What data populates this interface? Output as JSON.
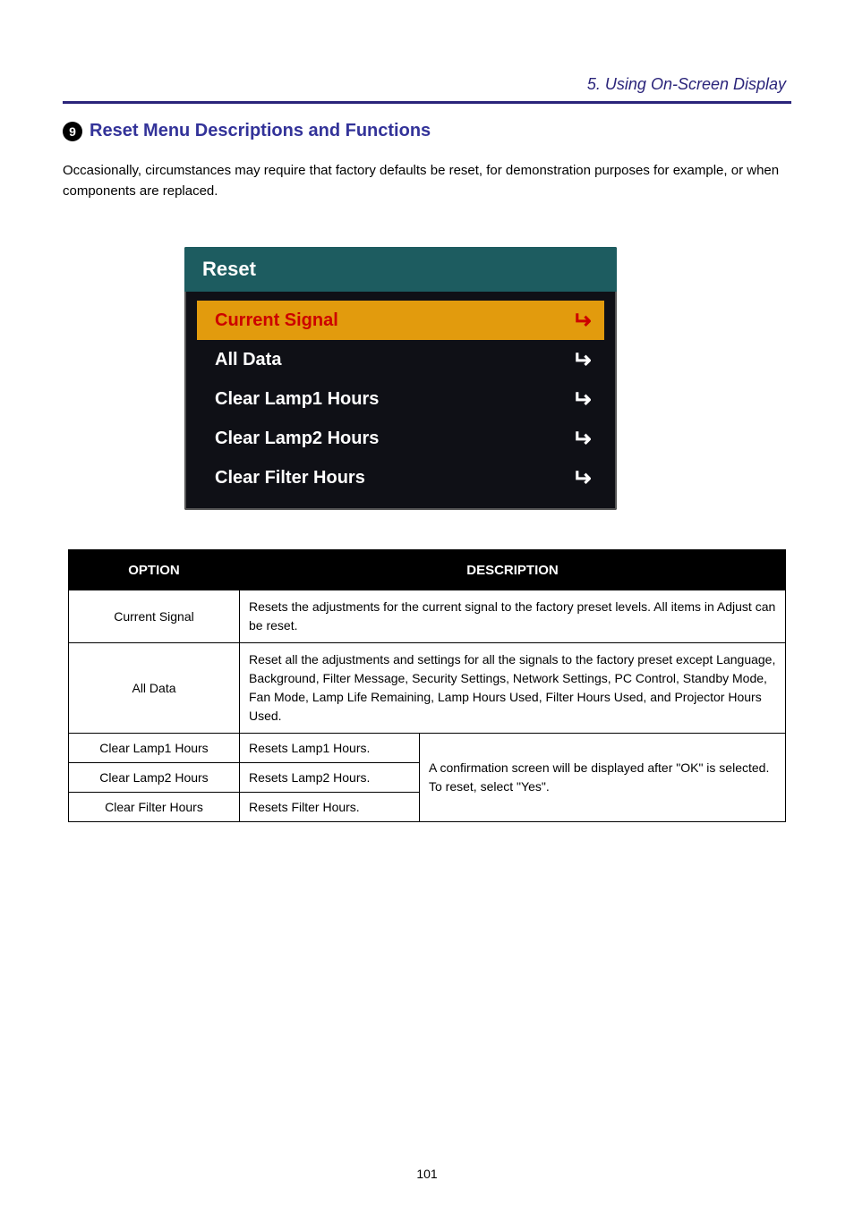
{
  "title_bar": "5. Using On-Screen Display",
  "section": {
    "number": "9",
    "heading": "Reset Menu Descriptions and Functions",
    "intro": "Occasionally, circumstances may require that factory defaults be reset, for demonstration purposes for example, or when components are replaced."
  },
  "osd": {
    "header": "Reset",
    "items": [
      {
        "label": "Current Signal",
        "selected": true
      },
      {
        "label": "All Data",
        "selected": false
      },
      {
        "label": "Clear Lamp1 Hours",
        "selected": false
      },
      {
        "label": "Clear Lamp2 Hours",
        "selected": false
      },
      {
        "label": "Clear Filter Hours",
        "selected": false
      }
    ]
  },
  "table": {
    "headers": {
      "option": "OPTION",
      "description": "DESCRIPTION"
    },
    "rows": {
      "current_signal": {
        "option": "Current Signal",
        "desc": "Resets the adjustments for the current signal to the factory preset levels. All items in Adjust can be reset."
      },
      "all_data": {
        "option": "All Data",
        "desc": "Reset all the adjustments and settings for all the signals to the factory preset except Language, Background, Filter Message, Security Settings, Network Settings, PC Control, Standby Mode, Fan Mode, Lamp Life Remaining, Lamp Hours Used, Filter Hours Used, and Projector Hours Used."
      },
      "lamp1": {
        "option": "Clear Lamp1 Hours",
        "sub": "Resets Lamp1 Hours."
      },
      "lamp2": {
        "option": "Clear Lamp2 Hours",
        "sub": "Resets Lamp2 Hours."
      },
      "filter": {
        "option": "Clear Filter Hours",
        "sub": "Resets Filter Hours."
      },
      "shared_instr": "A confirmation screen will be displayed after \"OK\" is selected. To reset, select \"Yes\"."
    }
  },
  "page_number": "101"
}
